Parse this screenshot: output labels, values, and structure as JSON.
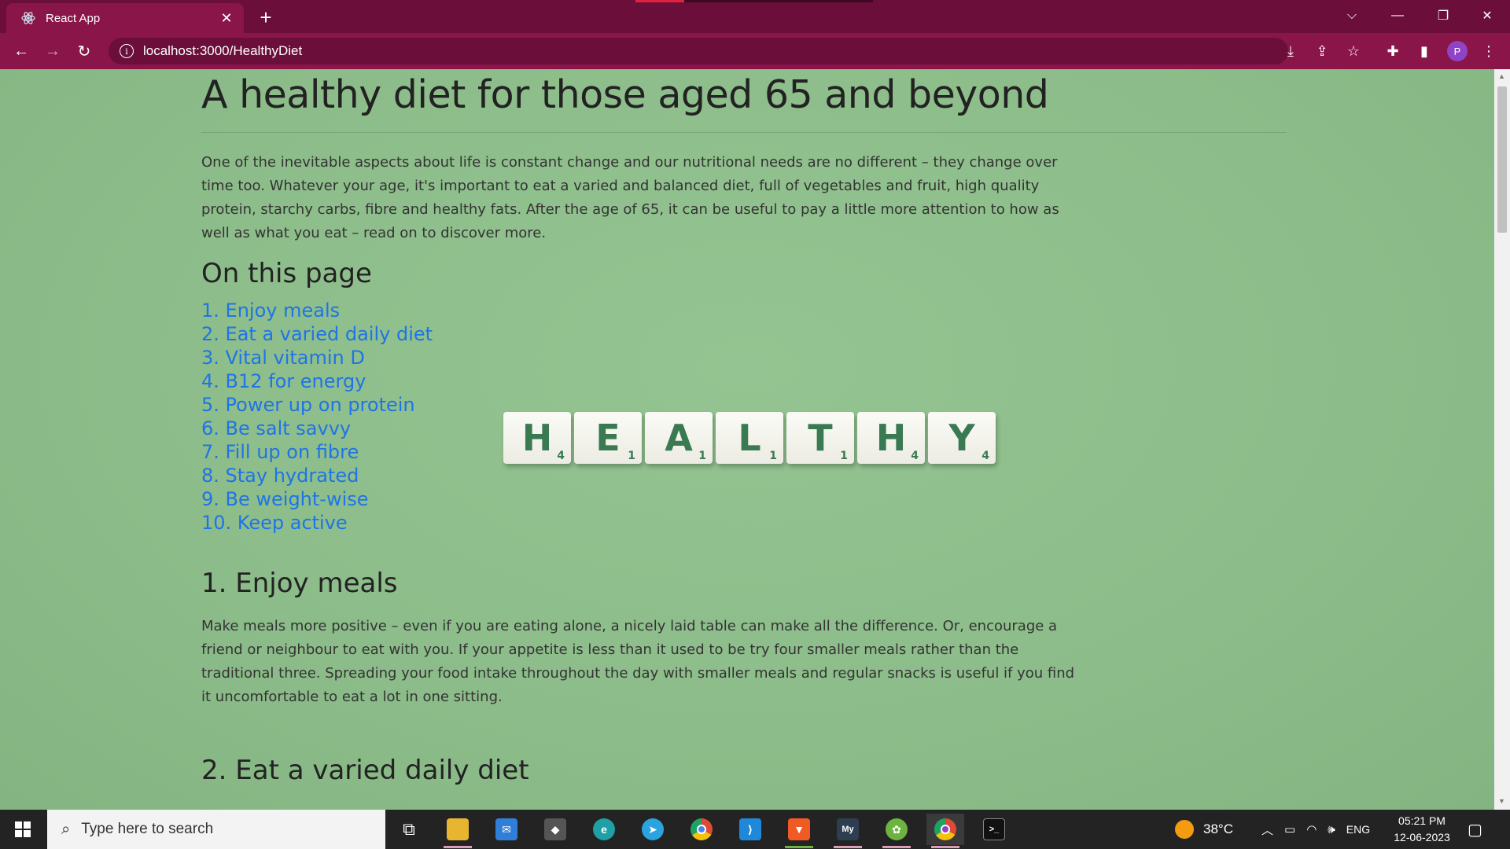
{
  "browser": {
    "tab_title": "React App",
    "tab_close": "✕",
    "new_tab": "+",
    "url": "localhost:3000/HealthyDiet",
    "profile_initial": "P",
    "window_controls": {
      "tabsearch": "⌵",
      "minimize": "—",
      "restore": "❐",
      "close": "✕"
    }
  },
  "page": {
    "title": "A healthy diet for those aged 65 and beyond",
    "intro": "One of the inevitable aspects about life is constant change and our nutritional needs are no different – they change over time too. Whatever your age, it's important to eat a varied and balanced diet, full of vegetables and fruit, high quality protein, starchy carbs, fibre and healthy fats. After the age of 65, it can be useful to pay a little more attention to how as well as what you eat – read on to discover more.",
    "toc_heading": "On this page",
    "toc": [
      "1. Enjoy meals",
      "2. Eat a varied daily diet",
      "3. Vital vitamin D",
      "4. B12 for energy",
      "5. Power up on protein",
      "6. Be salt savvy",
      "7. Fill up on fibre",
      "8. Stay hydrated",
      "9. Be weight-wise",
      "10. Keep active"
    ],
    "image_tiles": [
      {
        "letter": "H",
        "score": "4"
      },
      {
        "letter": "E",
        "score": "1"
      },
      {
        "letter": "A",
        "score": "1"
      },
      {
        "letter": "L",
        "score": "1"
      },
      {
        "letter": "T",
        "score": "1"
      },
      {
        "letter": "H",
        "score": "4"
      },
      {
        "letter": "Y",
        "score": "4"
      }
    ],
    "section1": {
      "heading": "1. Enjoy meals",
      "body": "Make meals more positive – even if you are eating alone, a nicely laid table can make all the difference. Or, encourage a friend or neighbour to eat with you. If your appetite is less than it used to be try four smaller meals rather than the traditional three. Spreading your food intake throughout the day with smaller meals and regular snacks is useful if you find it uncomfortable to eat a lot in one sitting."
    },
    "section2": {
      "heading": "2. Eat a varied daily diet"
    }
  },
  "taskbar": {
    "search_placeholder": "Type here to search",
    "weather": "38°C",
    "language": "ENG",
    "time": "05:21 PM",
    "date": "12-06-2023",
    "apps": [
      {
        "name": "task-view",
        "color": "#232323",
        "glyph": "⧉"
      },
      {
        "name": "file-explorer",
        "color": "#e8b531",
        "glyph": "▬"
      },
      {
        "name": "mail",
        "color": "#2f7fd8",
        "glyph": "✉"
      },
      {
        "name": "unity",
        "color": "#555555",
        "glyph": "◆"
      },
      {
        "name": "edge",
        "color": "#1fa0a6",
        "glyph": "e"
      },
      {
        "name": "telegram",
        "color": "#2aa3df",
        "glyph": "➤"
      },
      {
        "name": "chrome",
        "color": "#de4a36",
        "glyph": "◉"
      },
      {
        "name": "vscode",
        "color": "#1f88d8",
        "glyph": "⟩"
      },
      {
        "name": "brave",
        "color": "#f05a24",
        "glyph": "▼"
      },
      {
        "name": "mysql-workbench",
        "color": "#2c3e50",
        "glyph": "My"
      },
      {
        "name": "spring-tools",
        "color": "#6db33f",
        "glyph": "✿"
      },
      {
        "name": "chrome-profile",
        "color": "#c0392b",
        "glyph": "◉"
      },
      {
        "name": "terminal",
        "color": "#111111",
        "glyph": ">_"
      }
    ]
  }
}
